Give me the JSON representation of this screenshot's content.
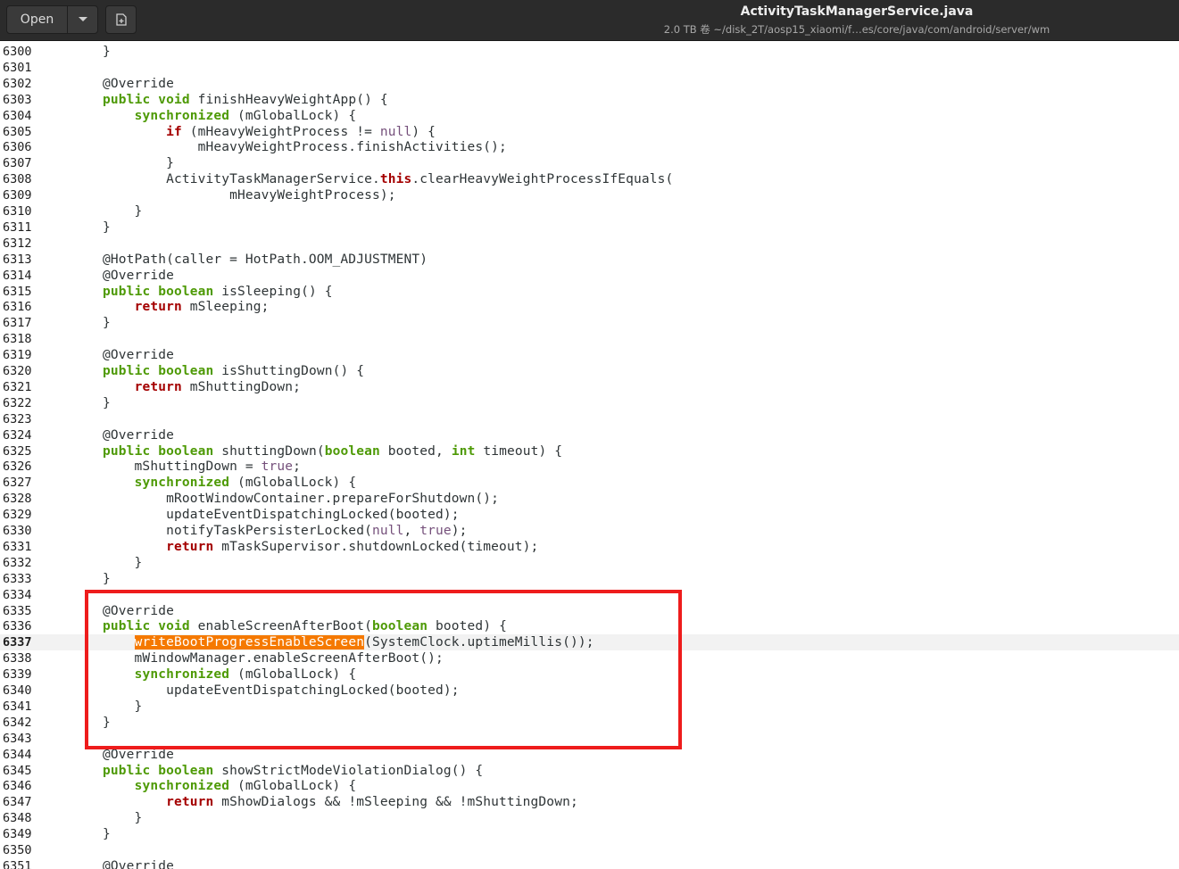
{
  "header": {
    "open_label": "Open",
    "title": "ActivityTaskManagerService.java",
    "subtitle": "2.0 TB 卷 ~/disk_2T/aosp15_xiaomi/f…es/core/java/com/android/server/wm",
    "icons": {
      "dropdown": "chevron-down-icon",
      "new_tab": "new-document-icon"
    }
  },
  "colors": {
    "keyword": "#4e9a06",
    "special_keyword": "#a40000",
    "literal": "#75507b",
    "search_highlight": "#f57900",
    "annotation_box": "#ee1c1c"
  },
  "editor": {
    "current_line": "6337",
    "lines": [
      {
        "n": "6300",
        "seg": [
          {
            "t": "        }"
          }
        ]
      },
      {
        "n": "6301",
        "seg": []
      },
      {
        "n": "6302",
        "seg": [
          {
            "t": "        @Override"
          }
        ]
      },
      {
        "n": "6303",
        "seg": [
          {
            "t": "        "
          },
          {
            "t": "public",
            "c": "kw"
          },
          {
            "t": " "
          },
          {
            "t": "void",
            "c": "kw"
          },
          {
            "t": " finishHeavyWeightApp() {"
          }
        ]
      },
      {
        "n": "6304",
        "seg": [
          {
            "t": "            "
          },
          {
            "t": "synchronized",
            "c": "kw"
          },
          {
            "t": " (mGlobalLock) {"
          }
        ]
      },
      {
        "n": "6305",
        "seg": [
          {
            "t": "                "
          },
          {
            "t": "if",
            "c": "kw2"
          },
          {
            "t": " (mHeavyWeightProcess != "
          },
          {
            "t": "null",
            "c": "lit"
          },
          {
            "t": ") {"
          }
        ]
      },
      {
        "n": "6306",
        "seg": [
          {
            "t": "                    mHeavyWeightProcess.finishActivities();"
          }
        ]
      },
      {
        "n": "6307",
        "seg": [
          {
            "t": "                }"
          }
        ]
      },
      {
        "n": "6308",
        "seg": [
          {
            "t": "                ActivityTaskManagerService."
          },
          {
            "t": "this",
            "c": "kw2"
          },
          {
            "t": ".clearHeavyWeightProcessIfEquals("
          }
        ]
      },
      {
        "n": "6309",
        "seg": [
          {
            "t": "                        mHeavyWeightProcess);"
          }
        ]
      },
      {
        "n": "6310",
        "seg": [
          {
            "t": "            }"
          }
        ]
      },
      {
        "n": "6311",
        "seg": [
          {
            "t": "        }"
          }
        ]
      },
      {
        "n": "6312",
        "seg": []
      },
      {
        "n": "6313",
        "seg": [
          {
            "t": "        @HotPath(caller = HotPath.OOM_ADJUSTMENT)"
          }
        ]
      },
      {
        "n": "6314",
        "seg": [
          {
            "t": "        @Override"
          }
        ]
      },
      {
        "n": "6315",
        "seg": [
          {
            "t": "        "
          },
          {
            "t": "public",
            "c": "kw"
          },
          {
            "t": " "
          },
          {
            "t": "boolean",
            "c": "kw"
          },
          {
            "t": " isSleeping() {"
          }
        ]
      },
      {
        "n": "6316",
        "seg": [
          {
            "t": "            "
          },
          {
            "t": "return",
            "c": "kw2"
          },
          {
            "t": " mSleeping;"
          }
        ]
      },
      {
        "n": "6317",
        "seg": [
          {
            "t": "        }"
          }
        ]
      },
      {
        "n": "6318",
        "seg": []
      },
      {
        "n": "6319",
        "seg": [
          {
            "t": "        @Override"
          }
        ]
      },
      {
        "n": "6320",
        "seg": [
          {
            "t": "        "
          },
          {
            "t": "public",
            "c": "kw"
          },
          {
            "t": " "
          },
          {
            "t": "boolean",
            "c": "kw"
          },
          {
            "t": " isShuttingDown() {"
          }
        ]
      },
      {
        "n": "6321",
        "seg": [
          {
            "t": "            "
          },
          {
            "t": "return",
            "c": "kw2"
          },
          {
            "t": " mShuttingDown;"
          }
        ]
      },
      {
        "n": "6322",
        "seg": [
          {
            "t": "        }"
          }
        ]
      },
      {
        "n": "6323",
        "seg": []
      },
      {
        "n": "6324",
        "seg": [
          {
            "t": "        @Override"
          }
        ]
      },
      {
        "n": "6325",
        "seg": [
          {
            "t": "        "
          },
          {
            "t": "public",
            "c": "kw"
          },
          {
            "t": " "
          },
          {
            "t": "boolean",
            "c": "kw"
          },
          {
            "t": " shuttingDown("
          },
          {
            "t": "boolean",
            "c": "kw"
          },
          {
            "t": " booted, "
          },
          {
            "t": "int",
            "c": "kw"
          },
          {
            "t": " timeout) {"
          }
        ]
      },
      {
        "n": "6326",
        "seg": [
          {
            "t": "            mShuttingDown = "
          },
          {
            "t": "true",
            "c": "lit"
          },
          {
            "t": ";"
          }
        ]
      },
      {
        "n": "6327",
        "seg": [
          {
            "t": "            "
          },
          {
            "t": "synchronized",
            "c": "kw"
          },
          {
            "t": " (mGlobalLock) {"
          }
        ]
      },
      {
        "n": "6328",
        "seg": [
          {
            "t": "                mRootWindowContainer.prepareForShutdown();"
          }
        ]
      },
      {
        "n": "6329",
        "seg": [
          {
            "t": "                updateEventDispatchingLocked(booted);"
          }
        ]
      },
      {
        "n": "6330",
        "seg": [
          {
            "t": "                notifyTaskPersisterLocked("
          },
          {
            "t": "null",
            "c": "lit"
          },
          {
            "t": ", "
          },
          {
            "t": "true",
            "c": "lit"
          },
          {
            "t": ");"
          }
        ]
      },
      {
        "n": "6331",
        "seg": [
          {
            "t": "                "
          },
          {
            "t": "return",
            "c": "kw2"
          },
          {
            "t": " mTaskSupervisor.shutdownLocked(timeout);"
          }
        ]
      },
      {
        "n": "6332",
        "seg": [
          {
            "t": "            }"
          }
        ]
      },
      {
        "n": "6333",
        "seg": [
          {
            "t": "        }"
          }
        ]
      },
      {
        "n": "6334",
        "seg": []
      },
      {
        "n": "6335",
        "seg": [
          {
            "t": "        @Override"
          }
        ]
      },
      {
        "n": "6336",
        "seg": [
          {
            "t": "        "
          },
          {
            "t": "public",
            "c": "kw"
          },
          {
            "t": " "
          },
          {
            "t": "void",
            "c": "kw"
          },
          {
            "t": " enableScreenAfterBoot("
          },
          {
            "t": "boolean",
            "c": "kw"
          },
          {
            "t": " booted) {"
          }
        ]
      },
      {
        "n": "6337",
        "seg": [
          {
            "t": "            "
          },
          {
            "t": "writeBootProgressEnableScreen",
            "c": "hl"
          },
          {
            "t": "(SystemClock.uptimeMillis());"
          }
        ]
      },
      {
        "n": "6338",
        "seg": [
          {
            "t": "            mWindowManager.enableScreenAfterBoot();"
          }
        ]
      },
      {
        "n": "6339",
        "seg": [
          {
            "t": "            "
          },
          {
            "t": "synchronized",
            "c": "kw"
          },
          {
            "t": " (mGlobalLock) {"
          }
        ]
      },
      {
        "n": "6340",
        "seg": [
          {
            "t": "                updateEventDispatchingLocked(booted);"
          }
        ]
      },
      {
        "n": "6341",
        "seg": [
          {
            "t": "            }"
          }
        ]
      },
      {
        "n": "6342",
        "seg": [
          {
            "t": "        }"
          }
        ]
      },
      {
        "n": "6343",
        "seg": []
      },
      {
        "n": "6344",
        "seg": [
          {
            "t": "        @Override"
          }
        ]
      },
      {
        "n": "6345",
        "seg": [
          {
            "t": "        "
          },
          {
            "t": "public",
            "c": "kw"
          },
          {
            "t": " "
          },
          {
            "t": "boolean",
            "c": "kw"
          },
          {
            "t": " showStrictModeViolationDialog() {"
          }
        ]
      },
      {
        "n": "6346",
        "seg": [
          {
            "t": "            "
          },
          {
            "t": "synchronized",
            "c": "kw"
          },
          {
            "t": " (mGlobalLock) {"
          }
        ]
      },
      {
        "n": "6347",
        "seg": [
          {
            "t": "                "
          },
          {
            "t": "return",
            "c": "kw2"
          },
          {
            "t": " mShowDialogs && !mSleeping && !mShuttingDown;"
          }
        ]
      },
      {
        "n": "6348",
        "seg": [
          {
            "t": "            }"
          }
        ]
      },
      {
        "n": "6349",
        "seg": [
          {
            "t": "        }"
          }
        ]
      },
      {
        "n": "6350",
        "seg": []
      },
      {
        "n": "6351",
        "seg": [
          {
            "t": "        @Override"
          }
        ]
      }
    ]
  }
}
